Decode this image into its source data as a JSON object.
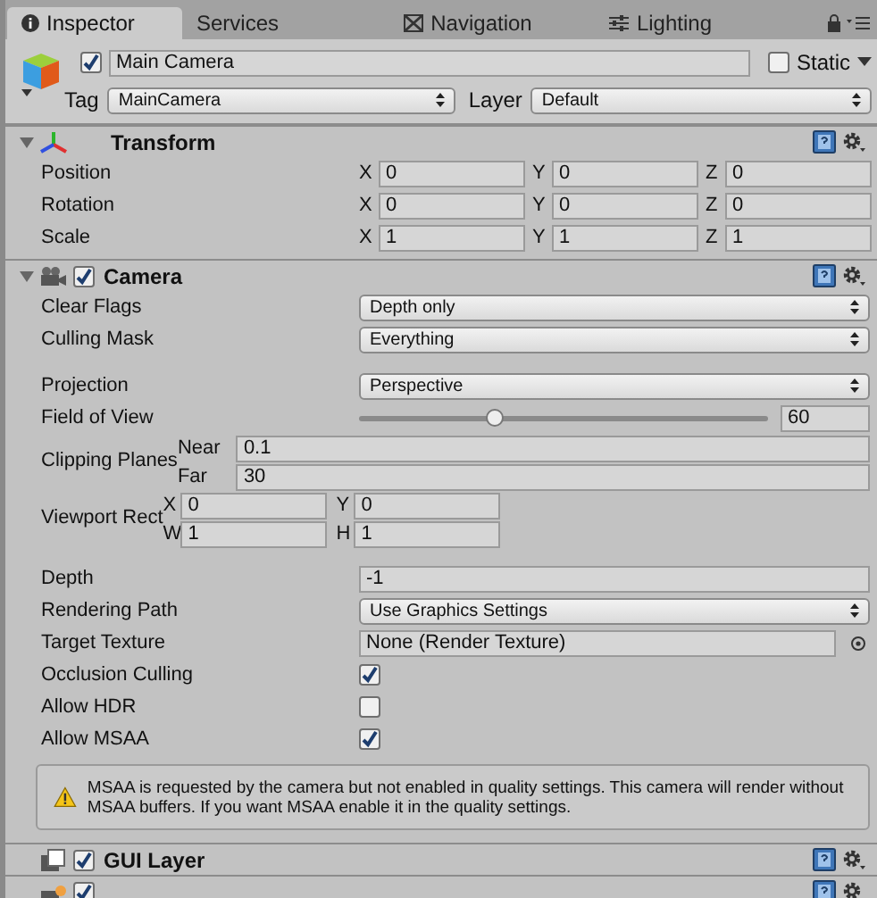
{
  "tabs": [
    {
      "label": "Inspector",
      "selected": true,
      "kind": "info"
    },
    {
      "label": "Services",
      "selected": false,
      "kind": "plain"
    },
    {
      "label": "Navigation",
      "selected": false,
      "kind": "navigation"
    },
    {
      "label": "Lighting",
      "selected": false,
      "kind": "lighting"
    }
  ],
  "object": {
    "active": true,
    "name": "Main Camera",
    "static": false,
    "static_label": "Static",
    "tag_label": "Tag",
    "tag": "MainCamera",
    "layer_label": "Layer",
    "layer": "Default"
  },
  "components": [
    {
      "kind": "transform",
      "title": "Transform",
      "expanded": true,
      "rows": [
        {
          "label": "Position",
          "axes": [
            {
              "axis": "X",
              "value": "0"
            },
            {
              "axis": "Y",
              "value": "0"
            },
            {
              "axis": "Z",
              "value": "0"
            }
          ]
        },
        {
          "label": "Rotation",
          "axes": [
            {
              "axis": "X",
              "value": "0"
            },
            {
              "axis": "Y",
              "value": "0"
            },
            {
              "axis": "Z",
              "value": "0"
            }
          ]
        },
        {
          "label": "Scale",
          "axes": [
            {
              "axis": "X",
              "value": "1"
            },
            {
              "axis": "Y",
              "value": "1"
            },
            {
              "axis": "Z",
              "value": "1"
            }
          ]
        }
      ]
    },
    {
      "kind": "camera",
      "title": "Camera",
      "enabled": true,
      "expanded": true,
      "groups": [
        [
          {
            "kind": "dropdown",
            "label": "Clear Flags",
            "value": "Depth only"
          },
          {
            "kind": "dropdown",
            "label": "Culling Mask",
            "value": "Everything"
          }
        ],
        [
          {
            "kind": "dropdown",
            "label": "Projection",
            "value": "Perspective"
          },
          {
            "kind": "slider",
            "label": "Field of View",
            "level": 0.33,
            "value": "60"
          },
          {
            "kind": "pair",
            "label": "Clipping Planes",
            "fields": [
              {
                "label": "Near",
                "value": "0.1"
              },
              {
                "label": "Far",
                "value": "30"
              }
            ]
          },
          {
            "kind": "rect",
            "label": "Viewport Rect",
            "fields": [
              {
                "label": "X",
                "value": "0"
              },
              {
                "label": "Y",
                "value": "0"
              },
              {
                "label": "W",
                "value": "1"
              },
              {
                "label": "H",
                "value": "1"
              }
            ]
          }
        ],
        [
          {
            "kind": "field",
            "label": "Depth",
            "value": "-1"
          },
          {
            "kind": "dropdown",
            "label": "Rendering Path",
            "value": "Use Graphics Settings"
          },
          {
            "kind": "object",
            "label": "Target Texture",
            "value": "None (Render Texture)"
          },
          {
            "kind": "checkbox",
            "label": "Occlusion Culling",
            "checked": true
          },
          {
            "kind": "checkbox",
            "label": "Allow HDR",
            "checked": false
          },
          {
            "kind": "checkbox",
            "label": "Allow MSAA",
            "checked": true
          }
        ]
      ],
      "warning": "MSAA is requested by the camera but not enabled in quality settings. This camera will render without MSAA buffers. If you want MSAA enable it in the quality settings."
    },
    {
      "kind": "layer",
      "title": "GUI Layer",
      "enabled": true
    },
    {
      "kind": "flare",
      "enabled": true
    }
  ]
}
